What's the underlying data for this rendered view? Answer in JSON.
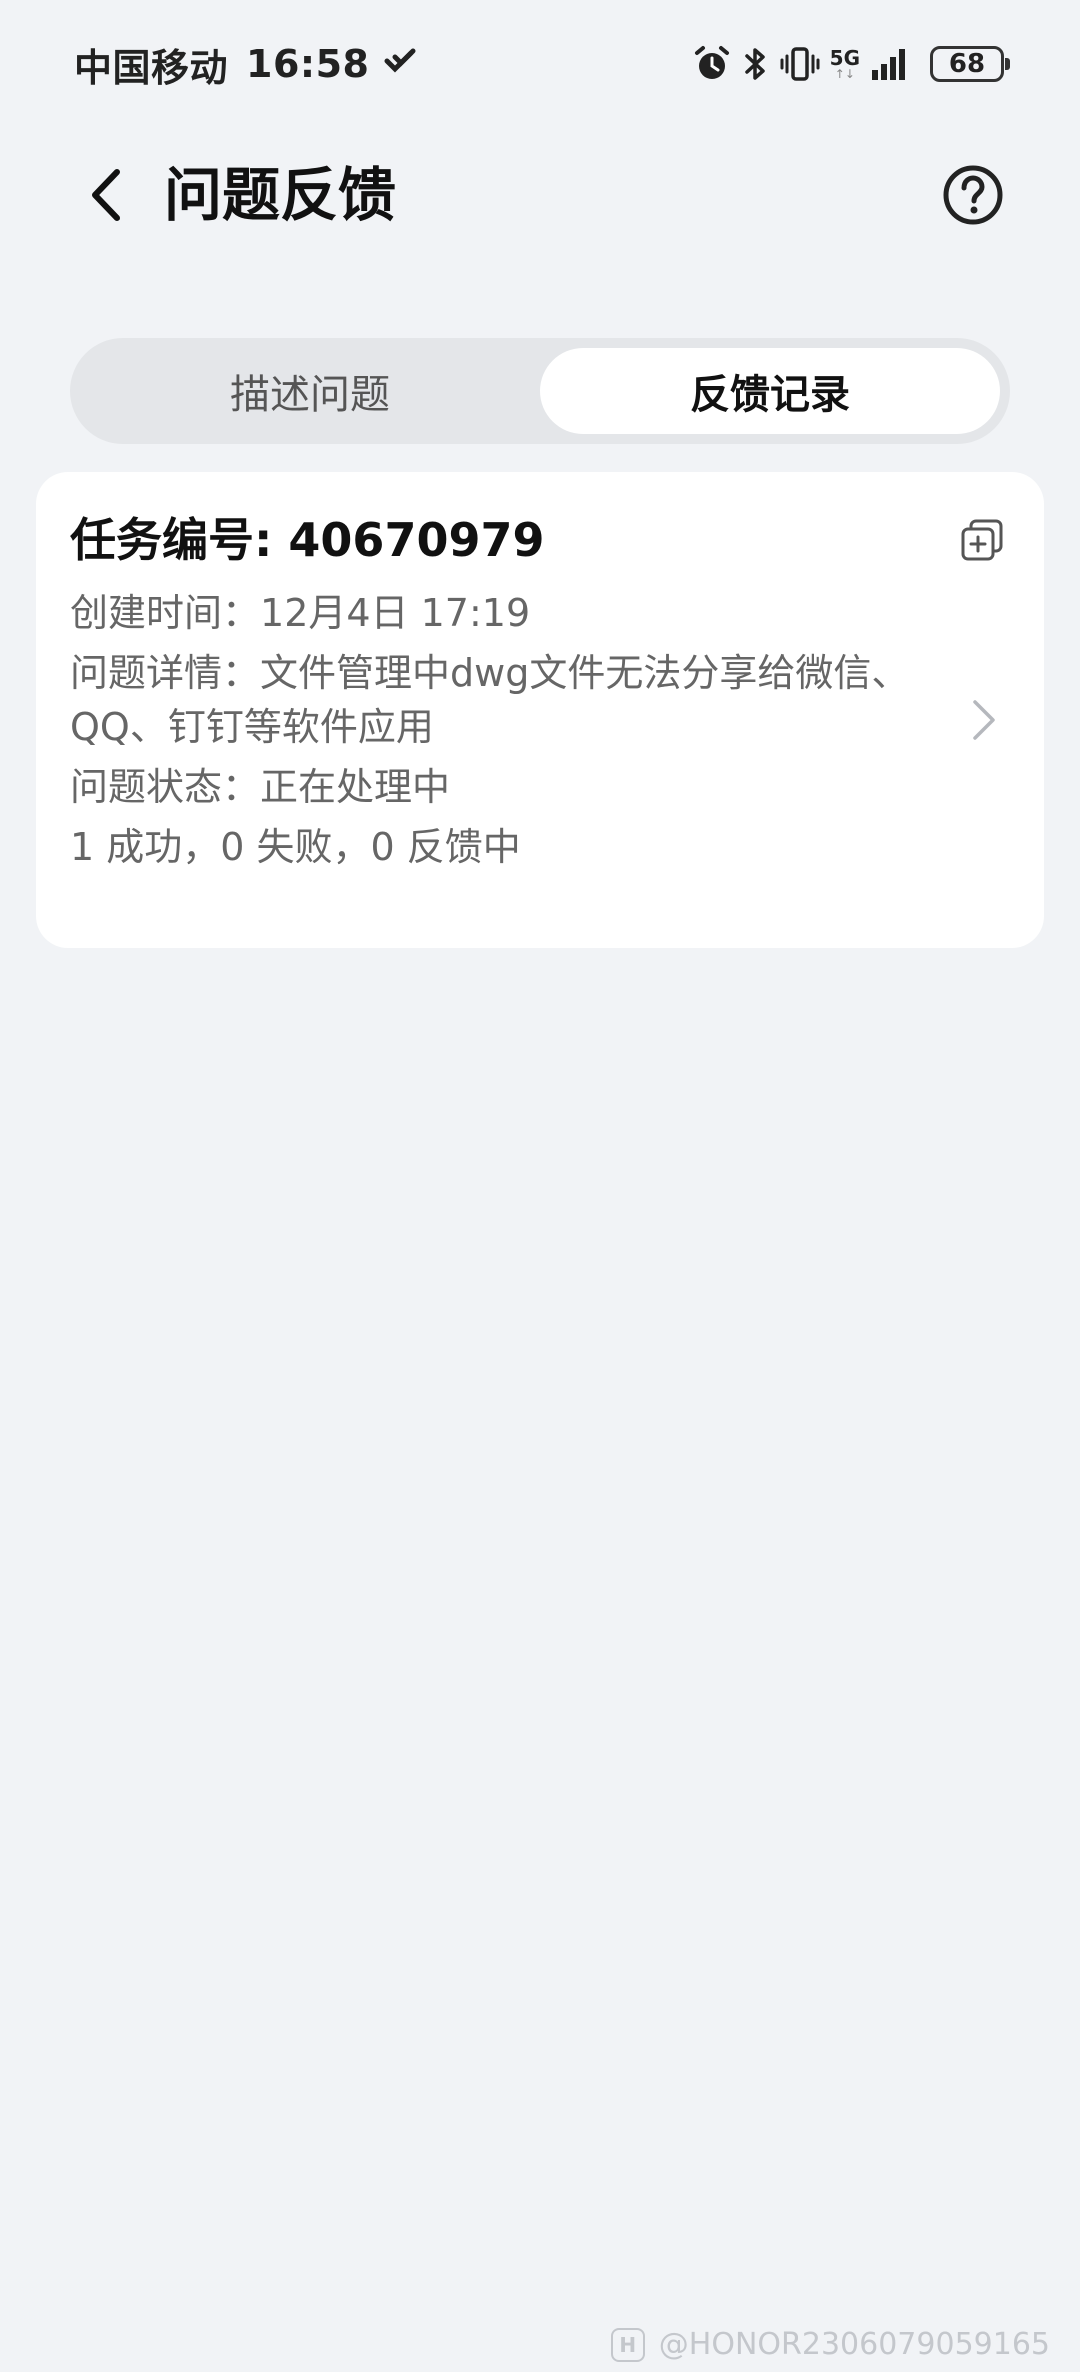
{
  "status_bar": {
    "carrier": "中国移动",
    "time": "16:58",
    "network": "5G",
    "battery": "68"
  },
  "header": {
    "title": "问题反馈"
  },
  "tabs": [
    {
      "label": "描述问题",
      "active": false
    },
    {
      "label": "反馈记录",
      "active": true
    }
  ],
  "record": {
    "task_label": "任务编号: ",
    "task_number": "40670979",
    "created_label": "创建时间：",
    "created_value": "12月4日 17:19",
    "details_label": "问题详情：",
    "details_value": "文件管理中dwg文件无法分享给微信、QQ、钉钉等软件应用",
    "status_label": "问题状态：",
    "status_value": "正在处理中",
    "summary": "1 成功，0 失败，0 反馈中"
  },
  "watermark": {
    "text": "@HONOR2306079059165"
  }
}
